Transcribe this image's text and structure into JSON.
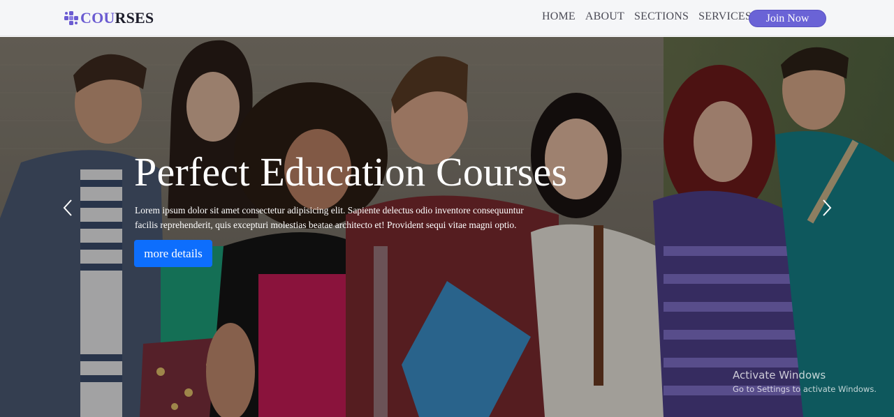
{
  "brand": {
    "accent_text": "COU",
    "rest_text": "RSES",
    "icon": "puzzle-logo-icon",
    "accent_color": "#6a5bd1"
  },
  "nav": {
    "items": [
      {
        "label": "HOME"
      },
      {
        "label": "ABOUT"
      },
      {
        "label": "SECTIONS"
      },
      {
        "label": "SERVICES"
      }
    ],
    "join_label": "Join Now",
    "join_color": "#6a63d6"
  },
  "hero": {
    "title": "Perfect Education Courses",
    "text": "Lorem ipsum dolor sit amet consectetur adipisicing elit. Sapiente delectus odio inventore consequuntur facilis reprehenderit, quis excepturi molestias beatae architecto et! Provident sequi vitae magni optio.",
    "button_label": "more details",
    "button_color": "#0d6efd",
    "prev_icon": "chevron-left-icon",
    "next_icon": "chevron-right-icon"
  },
  "watermark": {
    "line1": "Activate Windows",
    "line2": "Go to Settings to activate Windows."
  }
}
